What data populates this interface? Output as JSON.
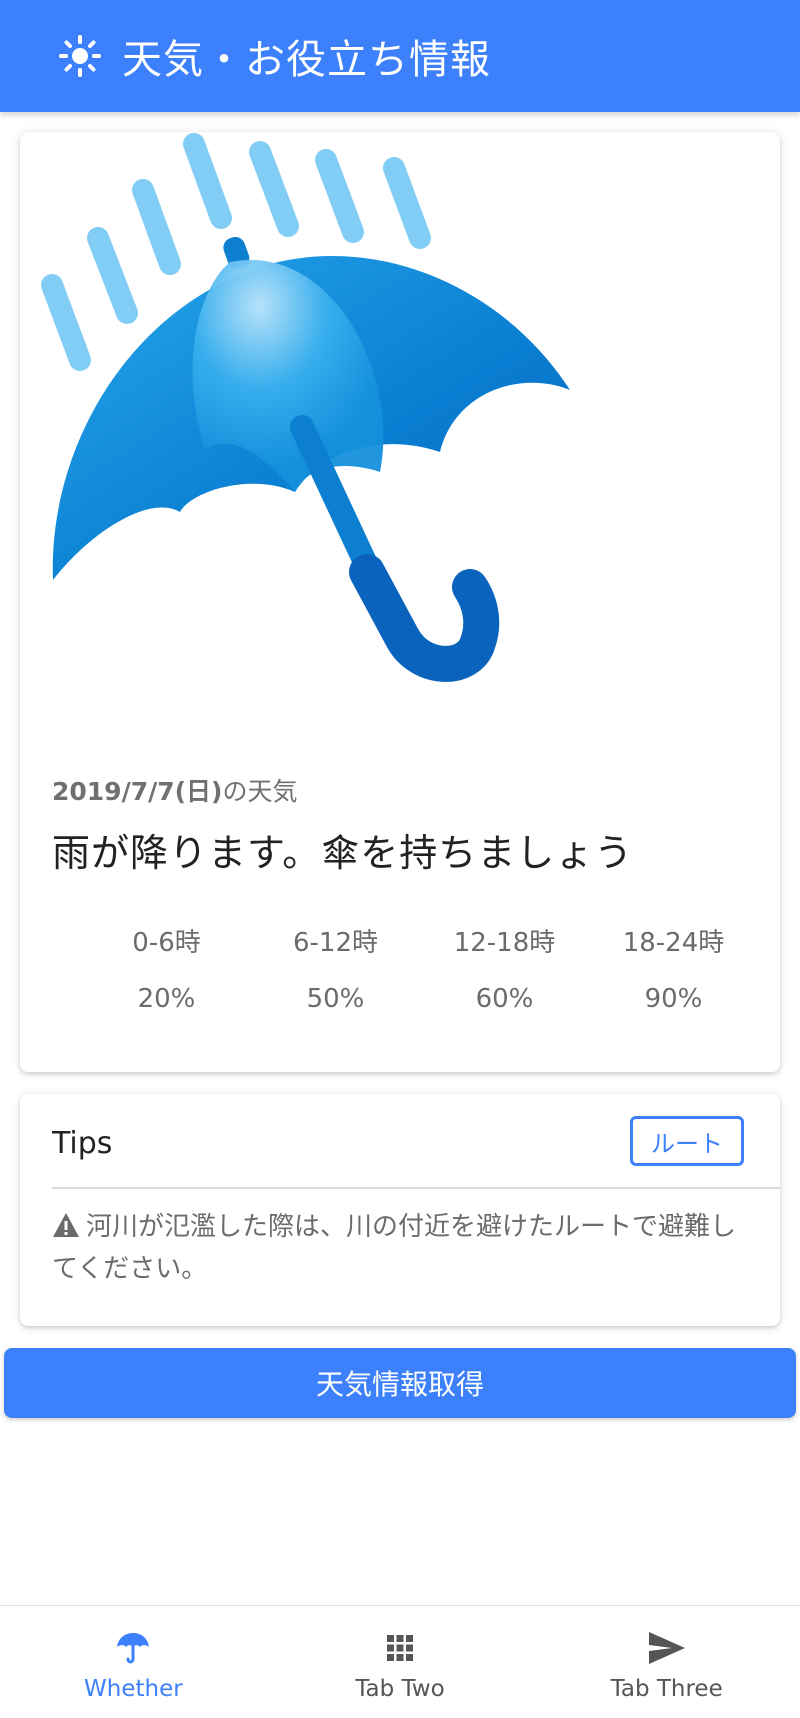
{
  "header": {
    "title": "天気・お役立ち情報",
    "icon": "sun-icon"
  },
  "weather": {
    "image_icon": "umbrella-rain-icon",
    "date": "2019/7/7(日)",
    "date_suffix": "の天気",
    "message": "雨が降ります。傘を持ちましょう",
    "slots": [
      {
        "time": "0-6時",
        "percent": "20%"
      },
      {
        "time": "6-12時",
        "percent": "50%"
      },
      {
        "time": "12-18時",
        "percent": "60%"
      },
      {
        "time": "18-24時",
        "percent": "90%"
      }
    ]
  },
  "tips": {
    "title": "Tips",
    "button_label": "ルート",
    "text": "河川が氾濫した際は、川の付近を避けたルートで避難してください。",
    "icon": "warning-icon"
  },
  "fetch_button": {
    "label": "天気情報取得"
  },
  "nav": {
    "items": [
      {
        "label": "Whether",
        "icon": "umbrella-icon",
        "active": true
      },
      {
        "label": "Tab Two",
        "icon": "grid-icon",
        "active": false
      },
      {
        "label": "Tab Three",
        "icon": "send-icon",
        "active": false
      }
    ]
  },
  "colors": {
    "primary": "#3d80fb",
    "rain": "#82cdf5",
    "umbrella": "#0d7fd1"
  }
}
